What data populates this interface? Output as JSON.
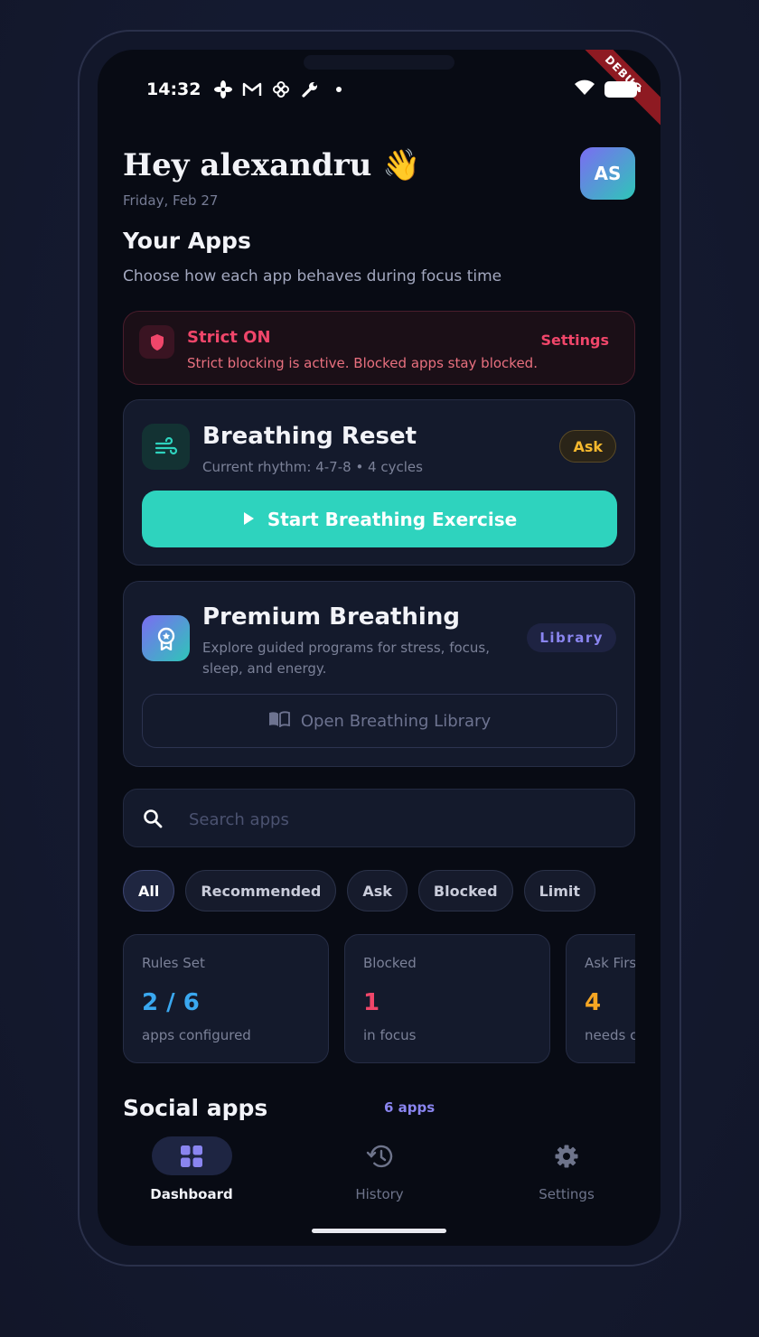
{
  "status_bar": {
    "time": "14:32",
    "icons": [
      "fan-icon",
      "gmail-icon",
      "pinwheel-icon",
      "wrench-icon",
      "dot-icon"
    ],
    "right_icons": [
      "wifi-icon",
      "battery-icon"
    ],
    "debug_label": "DEBUG"
  },
  "header": {
    "greeting": "Hey alexandru 👋",
    "date": "Friday, Feb 27",
    "avatar_initials": "AS"
  },
  "apps_section": {
    "title": "Your Apps",
    "subtitle": "Choose how each app behaves during focus time"
  },
  "strict_banner": {
    "title": "Strict ON",
    "description": "Strict blocking is active. Blocked apps stay blocked.",
    "action_label": "Settings"
  },
  "breathing_card": {
    "title": "Breathing Reset",
    "subtitle": "Current rhythm: 4-7-8 • 4 cycles",
    "badge": "Ask",
    "button_label": "Start Breathing Exercise"
  },
  "premium_card": {
    "title": "Premium Breathing",
    "subtitle": "Explore guided programs for stress, focus, sleep, and energy.",
    "badge": "Library",
    "button_label": "Open Breathing Library"
  },
  "search": {
    "placeholder": "Search apps",
    "value": ""
  },
  "filters": [
    {
      "label": "All",
      "active": true
    },
    {
      "label": "Recommended",
      "active": false
    },
    {
      "label": "Ask",
      "active": false
    },
    {
      "label": "Blocked",
      "active": false
    },
    {
      "label": "Limit",
      "active": false
    }
  ],
  "stats": [
    {
      "label": "Rules Set",
      "value": "2 / 6",
      "caption": "apps configured",
      "color": "#3aa8f0"
    },
    {
      "label": "Blocked",
      "value": "1",
      "caption": "in focus",
      "color": "#f0466a"
    },
    {
      "label": "Ask First",
      "value": "4",
      "caption": "needs check",
      "color": "#f5a623"
    }
  ],
  "social": {
    "title": "Social apps",
    "count": "6 apps"
  },
  "bottom_nav": [
    {
      "label": "Dashboard",
      "icon": "grid-icon",
      "active": true
    },
    {
      "label": "History",
      "icon": "history-icon",
      "active": false
    },
    {
      "label": "Settings",
      "icon": "gear-icon",
      "active": false
    }
  ],
  "colors": {
    "accent_teal": "#2ed3be",
    "accent_purple": "#8a85f0",
    "danger": "#f0466a",
    "warning": "#f5b82e"
  }
}
